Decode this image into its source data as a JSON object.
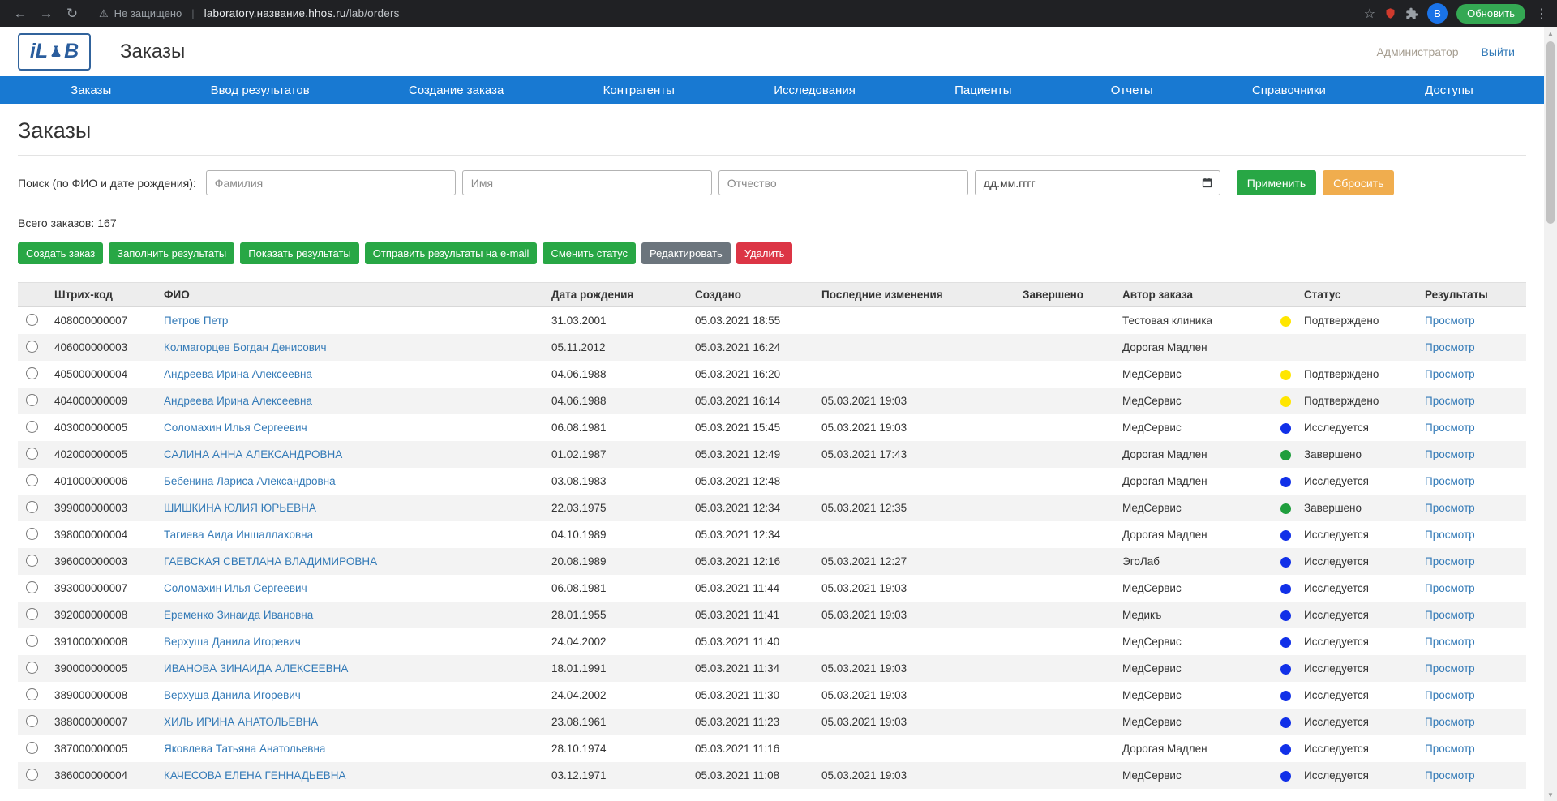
{
  "browser": {
    "security_label": "Не защищено",
    "url_host": "laboratory.название.hhos.ru",
    "url_path": "/lab/orders",
    "update_button": "Обновить",
    "profile_initial": "B"
  },
  "header": {
    "logo_prefix": "iL",
    "logo_suffix": "B",
    "app_title": "Заказы",
    "user_role": "Администратор",
    "logout_label": "Выйти"
  },
  "nav": {
    "items": [
      "Заказы",
      "Ввод результатов",
      "Создание заказа",
      "Контрагенты",
      "Исследования",
      "Пациенты",
      "Отчеты",
      "Справочники",
      "Доступы"
    ]
  },
  "page": {
    "title": "Заказы",
    "search": {
      "label": "Поиск (по ФИО и дате рождения):",
      "lastname_placeholder": "Фамилия",
      "firstname_placeholder": "Имя",
      "middlename_placeholder": "Отчество",
      "birthdate_placeholder": "дд.мм.гггг",
      "apply_label": "Применить",
      "reset_label": "Сбросить"
    },
    "totals": {
      "label": "Всего заказов:",
      "count": "167"
    },
    "actions": {
      "create": "Создать заказ",
      "fill_results": "Заполнить результаты",
      "show_results": "Показать результаты",
      "email_results": "Отправить результаты на e-mail",
      "change_status": "Сменить статус",
      "edit": "Редактировать",
      "delete": "Удалить"
    }
  },
  "table": {
    "headers": {
      "barcode": "Штрих-код",
      "name": "ФИО",
      "birthdate": "Дата рождения",
      "created": "Создано",
      "modified": "Последние изменения",
      "completed": "Завершено",
      "author": "Автор заказа",
      "status": "Статус",
      "results": "Результаты"
    },
    "view_label": "Просмотр",
    "rows": [
      {
        "barcode": "408000000007",
        "name": "Петров Петр",
        "birthdate": "31.03.2001",
        "created": "05.03.2021 18:55",
        "modified": "",
        "completed": "",
        "author": "Тестовая клиника",
        "status_color": "yellow",
        "status": "Подтверждено"
      },
      {
        "barcode": "406000000003",
        "name": "Колмагорцев Богдан Денисович",
        "birthdate": "05.11.2012",
        "created": "05.03.2021 16:24",
        "modified": "",
        "completed": "",
        "author": "Дорогая Мадлен",
        "status_color": "none",
        "status": ""
      },
      {
        "barcode": "405000000004",
        "name": "Андреева Ирина Алексеевна",
        "birthdate": "04.06.1988",
        "created": "05.03.2021 16:20",
        "modified": "",
        "completed": "",
        "author": "МедСервис",
        "status_color": "yellow",
        "status": "Подтверждено"
      },
      {
        "barcode": "404000000009",
        "name": "Андреева Ирина Алексеевна",
        "birthdate": "04.06.1988",
        "created": "05.03.2021 16:14",
        "modified": "05.03.2021 19:03",
        "completed": "",
        "author": "МедСервис",
        "status_color": "yellow",
        "status": "Подтверждено"
      },
      {
        "barcode": "403000000005",
        "name": "Соломахин Илья Сергеевич",
        "birthdate": "06.08.1981",
        "created": "05.03.2021 15:45",
        "modified": "05.03.2021 19:03",
        "completed": "",
        "author": "МедСервис",
        "status_color": "blue",
        "status": "Исследуется"
      },
      {
        "barcode": "402000000005",
        "name": "САЛИНА АННА АЛЕКСАНДРОВНА",
        "birthdate": "01.02.1987",
        "created": "05.03.2021 12:49",
        "modified": "05.03.2021 17:43",
        "completed": "",
        "author": "Дорогая Мадлен",
        "status_color": "green",
        "status": "Завершено"
      },
      {
        "barcode": "401000000006",
        "name": "Бебенина Лариса Александровна",
        "birthdate": "03.08.1983",
        "created": "05.03.2021 12:48",
        "modified": "",
        "completed": "",
        "author": "Дорогая Мадлен",
        "status_color": "blue",
        "status": "Исследуется"
      },
      {
        "barcode": "399000000003",
        "name": "ШИШКИНА ЮЛИЯ ЮРЬЕВНА",
        "birthdate": "22.03.1975",
        "created": "05.03.2021 12:34",
        "modified": "05.03.2021 12:35",
        "completed": "",
        "author": "МедСервис",
        "status_color": "green",
        "status": "Завершено"
      },
      {
        "barcode": "398000000004",
        "name": "Тагиева Аида Иншаллаховна",
        "birthdate": "04.10.1989",
        "created": "05.03.2021 12:34",
        "modified": "",
        "completed": "",
        "author": "Дорогая Мадлен",
        "status_color": "blue",
        "status": "Исследуется"
      },
      {
        "barcode": "396000000003",
        "name": "ГАЕВСКАЯ СВЕТЛАНА ВЛАДИМИРОВНА",
        "birthdate": "20.08.1989",
        "created": "05.03.2021 12:16",
        "modified": "05.03.2021 12:27",
        "completed": "",
        "author": "ЭгоЛаб",
        "status_color": "blue",
        "status": "Исследуется"
      },
      {
        "barcode": "393000000007",
        "name": "Соломахин Илья Сергеевич",
        "birthdate": "06.08.1981",
        "created": "05.03.2021 11:44",
        "modified": "05.03.2021 19:03",
        "completed": "",
        "author": "МедСервис",
        "status_color": "blue",
        "status": "Исследуется"
      },
      {
        "barcode": "392000000008",
        "name": "Еременко Зинаида Ивановна",
        "birthdate": "28.01.1955",
        "created": "05.03.2021 11:41",
        "modified": "05.03.2021 19:03",
        "completed": "",
        "author": "Медикъ",
        "status_color": "blue",
        "status": "Исследуется"
      },
      {
        "barcode": "391000000008",
        "name": "Верхуша Данила Игоревич",
        "birthdate": "24.04.2002",
        "created": "05.03.2021 11:40",
        "modified": "",
        "completed": "",
        "author": "МедСервис",
        "status_color": "blue",
        "status": "Исследуется"
      },
      {
        "barcode": "390000000005",
        "name": "ИВАНОВА ЗИНАИДА АЛЕКСЕЕВНА",
        "birthdate": "18.01.1991",
        "created": "05.03.2021 11:34",
        "modified": "05.03.2021 19:03",
        "completed": "",
        "author": "МедСервис",
        "status_color": "blue",
        "status": "Исследуется"
      },
      {
        "barcode": "389000000008",
        "name": "Верхуша Данила Игоревич",
        "birthdate": "24.04.2002",
        "created": "05.03.2021 11:30",
        "modified": "05.03.2021 19:03",
        "completed": "",
        "author": "МедСервис",
        "status_color": "blue",
        "status": "Исследуется"
      },
      {
        "barcode": "388000000007",
        "name": "ХИЛЬ ИРИНА АНАТОЛЬЕВНА",
        "birthdate": "23.08.1961",
        "created": "05.03.2021 11:23",
        "modified": "05.03.2021 19:03",
        "completed": "",
        "author": "МедСервис",
        "status_color": "blue",
        "status": "Исследуется"
      },
      {
        "barcode": "387000000005",
        "name": "Яковлева Татьяна Анатольевна",
        "birthdate": "28.10.1974",
        "created": "05.03.2021 11:16",
        "modified": "",
        "completed": "",
        "author": "Дорогая Мадлен",
        "status_color": "blue",
        "status": "Исследуется"
      },
      {
        "barcode": "386000000004",
        "name": "КАЧЕСОВА ЕЛЕНА ГЕННАДЬЕВНА",
        "birthdate": "03.12.1971",
        "created": "05.03.2021 11:08",
        "modified": "05.03.2021 19:03",
        "completed": "",
        "author": "МедСервис",
        "status_color": "blue",
        "status": "Исследуется"
      }
    ]
  },
  "colors": {
    "nav_blue": "#1879d2",
    "link": "#337ab7",
    "button_green": "#28a745",
    "button_orange": "#f0ad4e",
    "button_gray": "#6c757d",
    "button_red": "#dc3545",
    "status_dots": {
      "yellow": "#ffe600",
      "blue": "#1130e8",
      "green": "#1f9e3d"
    }
  }
}
